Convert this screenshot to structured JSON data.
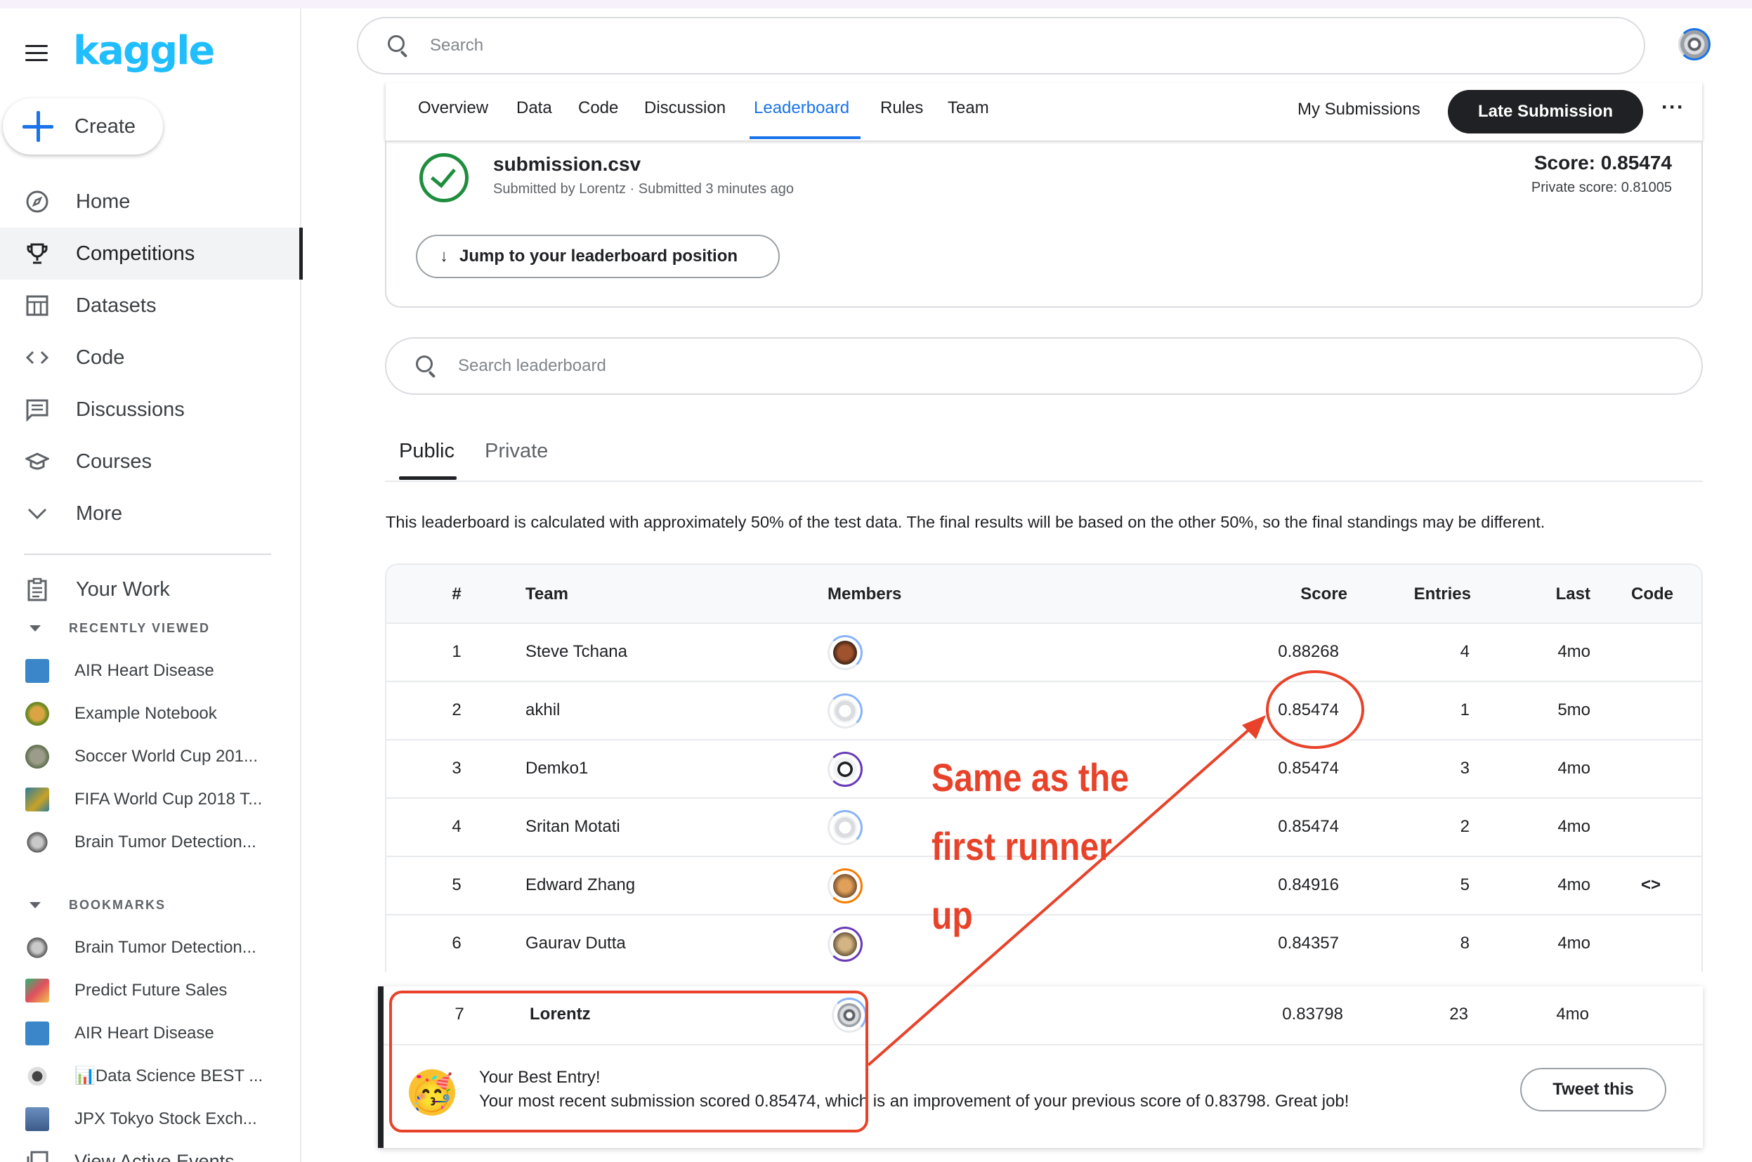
{
  "app": {
    "logo": "kaggle"
  },
  "sidebar": {
    "create_label": "Create",
    "nav": [
      {
        "label": "Home",
        "icon": "compass-icon"
      },
      {
        "label": "Competitions",
        "icon": "trophy-icon",
        "active": true
      },
      {
        "label": "Datasets",
        "icon": "table-icon"
      },
      {
        "label": "Code",
        "icon": "code-icon"
      },
      {
        "label": "Discussions",
        "icon": "comments-icon"
      },
      {
        "label": "Courses",
        "icon": "graduation-cap-icon"
      },
      {
        "label": "More",
        "icon": "chevron-down-icon"
      }
    ],
    "your_work": "Your Work",
    "recently_viewed_title": "RECENTLY VIEWED",
    "recently_viewed": [
      "AIR Heart Disease",
      "Example Notebook",
      "Soccer World Cup 201...",
      "FIFA World Cup 2018 T...",
      "Brain Tumor Detection..."
    ],
    "bookmarks_title": "BOOKMARKS",
    "bookmarks": [
      "Brain Tumor Detection...",
      "Predict Future Sales",
      "AIR Heart Disease",
      "📊Data Science BEST ...",
      "JPX Tokyo Stock Exch...",
      "View Active Events"
    ]
  },
  "top_search": {
    "placeholder": "Search"
  },
  "competition_nav": {
    "tabs": [
      "Overview",
      "Data",
      "Code",
      "Discussion",
      "Leaderboard",
      "Rules",
      "Team"
    ],
    "active_tab": "Leaderboard",
    "my_submissions": "My Submissions",
    "late_submission": "Late Submission",
    "more": "···"
  },
  "submission": {
    "file": "submission.csv",
    "meta": "Submitted by Lorentz · Submitted 3 minutes ago",
    "score": "Score: 0.85474",
    "private_score": "Private score: 0.81005",
    "jump_label": "Jump to your leaderboard position",
    "jump_arrow": "↓"
  },
  "leaderboard_search": {
    "placeholder": "Search leaderboard"
  },
  "leaderboard_tabs": {
    "public": "Public",
    "private": "Private"
  },
  "leaderboard_note": "This leaderboard is calculated with approximately 50% of the test data. The final results will be based on the other 50%, so the final standings may be different.",
  "table": {
    "headers": {
      "rank": "#",
      "team": "Team",
      "members": "Members",
      "score": "Score",
      "entries": "Entries",
      "last": "Last",
      "code": "Code"
    },
    "rows": [
      {
        "rank": "1",
        "team": "Steve Tchana",
        "score": "0.88268",
        "entries": "4",
        "last": "4mo",
        "code": ""
      },
      {
        "rank": "2",
        "team": "akhil",
        "score": "0.85474",
        "entries": "1",
        "last": "5mo",
        "code": ""
      },
      {
        "rank": "3",
        "team": "Demko1",
        "score": "0.85474",
        "entries": "3",
        "last": "4mo",
        "code": ""
      },
      {
        "rank": "4",
        "team": "Sritan Motati",
        "score": "0.85474",
        "entries": "2",
        "last": "4mo",
        "code": ""
      },
      {
        "rank": "5",
        "team": "Edward Zhang",
        "score": "0.84916",
        "entries": "5",
        "last": "4mo",
        "code": "<>"
      },
      {
        "rank": "6",
        "team": "Gaurav Dutta",
        "score": "0.84357",
        "entries": "8",
        "last": "4mo",
        "code": ""
      }
    ],
    "your_row": {
      "rank": "7",
      "team": "Lorentz",
      "score": "0.83798",
      "entries": "23",
      "last": "4mo"
    }
  },
  "best_entry": {
    "title": "Your Best Entry!",
    "message": "Your most recent submission scored 0.85474, which is an improvement of your previous score of 0.83798. Great job!",
    "tweet": "Tweet this",
    "emoji": "🥳"
  },
  "annotation": {
    "line1": "Same as the",
    "line2": "first runner",
    "line3": "up",
    "color": "#e8432a"
  }
}
